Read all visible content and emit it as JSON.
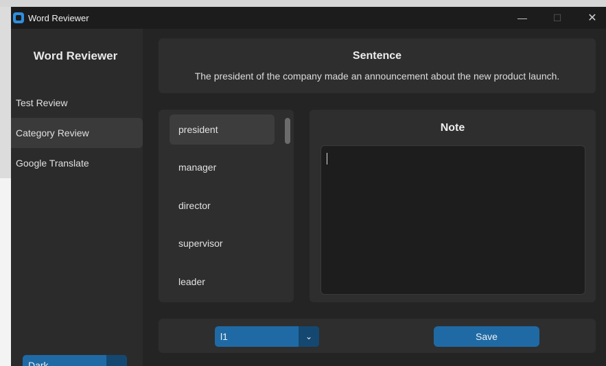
{
  "window": {
    "title": "Word Reviewer",
    "controls": {
      "minimize": "—",
      "maximize": "☐",
      "close": "✕"
    }
  },
  "sidebar": {
    "title": "Word Reviewer",
    "items": [
      {
        "label": "Test Review",
        "active": false
      },
      {
        "label": "Category Review",
        "active": true
      },
      {
        "label": "Google Translate",
        "active": false
      }
    ],
    "theme_dropdown": {
      "value": "Dark"
    }
  },
  "sentence": {
    "heading": "Sentence",
    "text": "The president of the company made an announcement about the new product launch."
  },
  "words": {
    "items": [
      "president",
      "manager",
      "director",
      "supervisor",
      "leader"
    ],
    "selected": "president"
  },
  "note": {
    "heading": "Note",
    "value": ""
  },
  "bottom": {
    "level_dropdown": {
      "value": "l1"
    },
    "save_label": "Save"
  },
  "colors": {
    "accent": "#1f6aa5",
    "accent_dark": "#144870",
    "background": "#242424",
    "panel": "#2e2e2e"
  }
}
